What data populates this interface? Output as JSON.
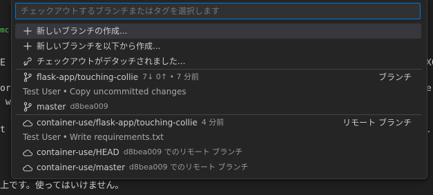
{
  "search": {
    "placeholder": "チェックアウトするブランチまたはタグを選択します"
  },
  "actions": [
    {
      "icon": "plus-icon",
      "label": "新しいブランチの作成..."
    },
    {
      "icon": "plus-icon",
      "label": "新しいブランチを以下から作成..."
    },
    {
      "icon": "debug-disconnect-icon",
      "label": "チェックアウトがデタッチされました..."
    }
  ],
  "local_branches": [
    {
      "icon": "git-branch-icon",
      "name": "flask-app/touching-collie",
      "desc": "7↓ 0↑ • 7 分前",
      "kind": "ブランチ",
      "author": "Test User",
      "message": "Copy uncommitted changes"
    },
    {
      "icon": "git-branch-icon",
      "name": "master",
      "desc": "d8bea009"
    }
  ],
  "remote_branches": [
    {
      "icon": "cloud-icon",
      "name": "container-use/flask-app/touching-collie",
      "desc": "4 分前",
      "kind": "リモート ブランチ",
      "author": "Test User",
      "message": "Write requirements.txt"
    },
    {
      "icon": "cloud-icon",
      "name": "container-use/HEAD",
      "desc": "d8bea009 でのリモート ブランチ"
    },
    {
      "icon": "cloud-icon",
      "name": "container-use/master",
      "desc": "d8bea009 でのリモート ブランチ"
    }
  ],
  "background": {
    "left_fragments": [
      "mc",
      "E",
      "or",
      " w",
      "t"
    ],
    "right_fragments": [
      "XC",
      "er",
      "."
    ],
    "bottom_text": "上です。使ってはいけません。"
  }
}
